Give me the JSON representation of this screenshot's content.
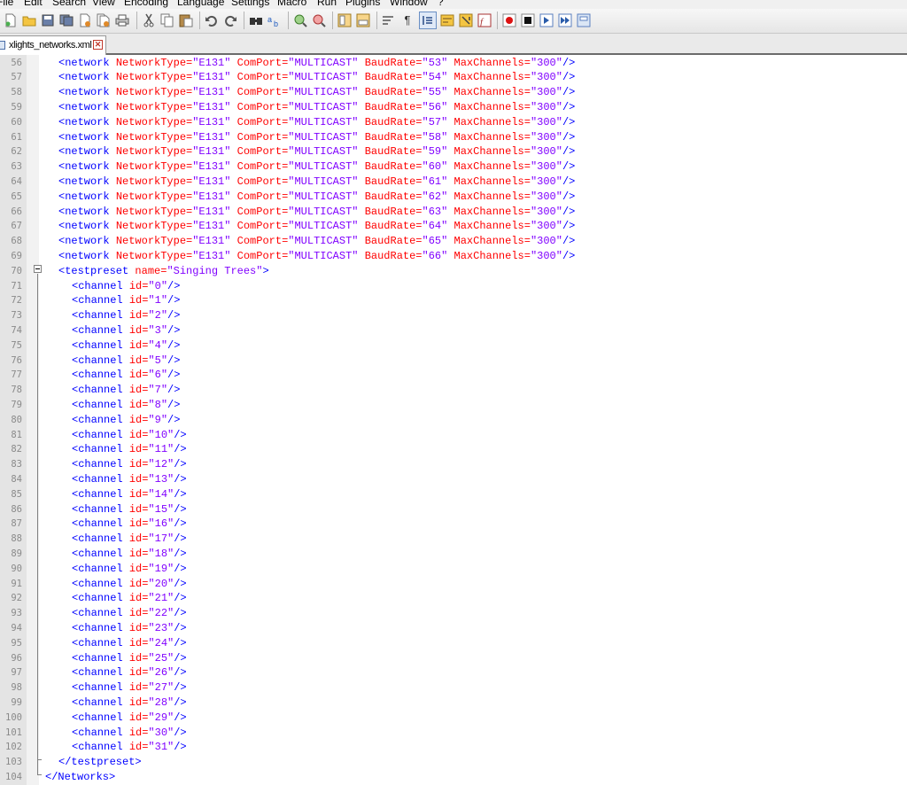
{
  "menu": [
    "File",
    "Edit",
    "Search",
    "View",
    "Encoding",
    "Language",
    "Settings",
    "Macro",
    "Run",
    "Plugins",
    "Window",
    "?"
  ],
  "toolbar": {
    "icons": [
      "new-file-icon",
      "open-icon",
      "save-icon",
      "save-all-icon",
      "close-icon",
      "close-all-icon",
      "print-icon",
      "cut-icon",
      "copy-icon",
      "paste-icon",
      "undo-icon",
      "redo-icon",
      "find-icon",
      "replace-icon",
      "zoom-in-icon",
      "zoom-out-icon",
      "sync-vertical-icon",
      "sync-horizontal-icon",
      "word-wrap-icon",
      "show-all-characters-icon",
      "indent-guide-icon",
      "user-language-icon",
      "doc-map-icon",
      "function-list-icon",
      "record-macro-icon",
      "stop-macro-icon",
      "play-macro-icon",
      "run-macro-multiple-icon",
      "save-macro-icon"
    ]
  },
  "tab": {
    "label": "xlights_networks.xml"
  },
  "colors": {
    "tag": "#0000ff",
    "attribute": "#ff0000",
    "value": "#8000ff",
    "line_number": "#8a8a8a"
  },
  "editor": {
    "network_lines": [
      {
        "ln": "56",
        "baud": "\"53\""
      },
      {
        "ln": "57",
        "baud": "\"54\""
      },
      {
        "ln": "58",
        "baud": "\"55\""
      },
      {
        "ln": "59",
        "baud": "\"56\""
      },
      {
        "ln": "60",
        "baud": "\"57\""
      },
      {
        "ln": "61",
        "baud": "\"58\""
      },
      {
        "ln": "62",
        "baud": "\"59\""
      },
      {
        "ln": "63",
        "baud": "\"60\""
      },
      {
        "ln": "64",
        "baud": "\"61\""
      },
      {
        "ln": "65",
        "baud": "\"62\""
      },
      {
        "ln": "66",
        "baud": "\"63\""
      },
      {
        "ln": "67",
        "baud": "\"64\""
      },
      {
        "ln": "68",
        "baud": "\"65\""
      },
      {
        "ln": "69",
        "baud": "\"66\""
      }
    ],
    "network_parts": {
      "open": "<network",
      "type_attr": "NetworkType=",
      "type_val": "\"E131\"",
      "port_attr": "ComPort=",
      "port_val": "\"MULTICAST\"",
      "baud_attr": "BaudRate=",
      "max_attr": "MaxChannels=",
      "max_val": "\"300\"",
      "close": "/>"
    },
    "testpreset": {
      "ln": "70",
      "open": "<testpreset",
      "name_attr": "name=",
      "name_val": "\"Singing Trees\"",
      "close": ">"
    },
    "channel_parts": {
      "open": "<channel",
      "attr": "id=",
      "close": "/>"
    },
    "channel_lines": [
      {
        "ln": "71",
        "id": "\"0\""
      },
      {
        "ln": "72",
        "id": "\"1\""
      },
      {
        "ln": "73",
        "id": "\"2\""
      },
      {
        "ln": "74",
        "id": "\"3\""
      },
      {
        "ln": "75",
        "id": "\"4\""
      },
      {
        "ln": "76",
        "id": "\"5\""
      },
      {
        "ln": "77",
        "id": "\"6\""
      },
      {
        "ln": "78",
        "id": "\"7\""
      },
      {
        "ln": "79",
        "id": "\"8\""
      },
      {
        "ln": "80",
        "id": "\"9\""
      },
      {
        "ln": "81",
        "id": "\"10\""
      },
      {
        "ln": "82",
        "id": "\"11\""
      },
      {
        "ln": "83",
        "id": "\"12\""
      },
      {
        "ln": "84",
        "id": "\"13\""
      },
      {
        "ln": "85",
        "id": "\"14\""
      },
      {
        "ln": "86",
        "id": "\"15\""
      },
      {
        "ln": "87",
        "id": "\"16\""
      },
      {
        "ln": "88",
        "id": "\"17\""
      },
      {
        "ln": "89",
        "id": "\"18\""
      },
      {
        "ln": "90",
        "id": "\"19\""
      },
      {
        "ln": "91",
        "id": "\"20\""
      },
      {
        "ln": "92",
        "id": "\"21\""
      },
      {
        "ln": "93",
        "id": "\"22\""
      },
      {
        "ln": "94",
        "id": "\"23\""
      },
      {
        "ln": "95",
        "id": "\"24\""
      },
      {
        "ln": "96",
        "id": "\"25\""
      },
      {
        "ln": "97",
        "id": "\"26\""
      },
      {
        "ln": "98",
        "id": "\"27\""
      },
      {
        "ln": "99",
        "id": "\"28\""
      },
      {
        "ln": "100",
        "id": "\"29\""
      },
      {
        "ln": "101",
        "id": "\"30\""
      },
      {
        "ln": "102",
        "id": "\"31\""
      }
    ],
    "end_testpreset": {
      "ln": "103",
      "text": "</testpreset>"
    },
    "end_networks": {
      "ln": "104",
      "text": "</Networks>"
    }
  }
}
